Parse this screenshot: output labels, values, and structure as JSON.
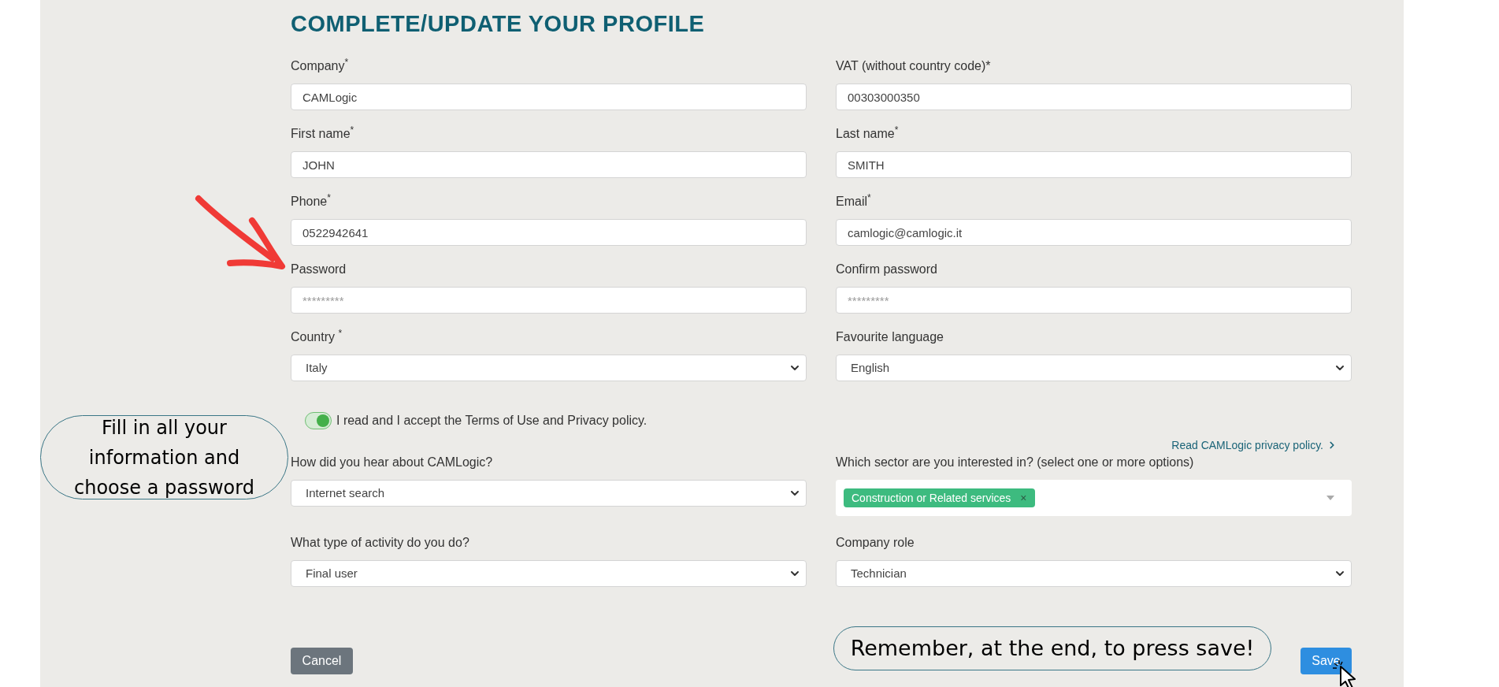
{
  "title": "COMPLETE/UPDATE YOUR PROFILE",
  "fields": [
    {
      "label": "Company$^{*}$",
      "kind": "text",
      "value": "CAMLogic"
    },
    {
      "label": "VAT (without country code)*",
      "kind": "text",
      "value": "00303000350"
    },
    {
      "label": "First name$^{*}$",
      "kind": "text",
      "value": "JOHN"
    },
    {
      "label": "Last name$^{*}$",
      "kind": "text",
      "value": "SMITH"
    },
    {
      "label": "Phone$^{*}$",
      "kind": "text",
      "value": "0522942641"
    },
    {
      "label": "Email$^{*}$",
      "kind": "text",
      "value": "camlogic@camlogic.it"
    },
    {
      "label": "Password",
      "kind": "password",
      "placeholder": "*********"
    },
    {
      "label": "Confirm password",
      "kind": "password",
      "placeholder": "*********"
    },
    {
      "label": "Country $^{*}$",
      "kind": "select",
      "value": "Italy"
    },
    {
      "label": "Favourite language",
      "kind": "select",
      "value": "English"
    }
  ],
  "consent": {
    "on": true,
    "label": "I read and I accept the Terms of Use and Privacy policy."
  },
  "privacy_link": {
    "label": "Read CAMLogic privacy policy."
  },
  "more_fields": [
    {
      "label": "How did you hear about CAMLogic?",
      "kind": "select",
      "value": "Internet search"
    },
    {
      "label": "Which sector are you interested in? (select one or more options)",
      "kind": "multiselect",
      "tags": [
        {
          "label": "Construction or Related services",
          "remove": "×",
          "color": "#3dbb7f"
        }
      ]
    },
    {
      "label": "What type of activity do you do?",
      "kind": "select",
      "value": "Final user"
    },
    {
      "label": "Company role",
      "kind": "select",
      "value": "Technician"
    }
  ],
  "buttons": {
    "cancel": "Cancel",
    "save": "Save"
  },
  "annotations": [
    {
      "kind": "bubble",
      "text": "Fill in all your information and choose a password"
    },
    {
      "kind": "bubble",
      "text": "Remember, at the end, to press save!"
    }
  ]
}
